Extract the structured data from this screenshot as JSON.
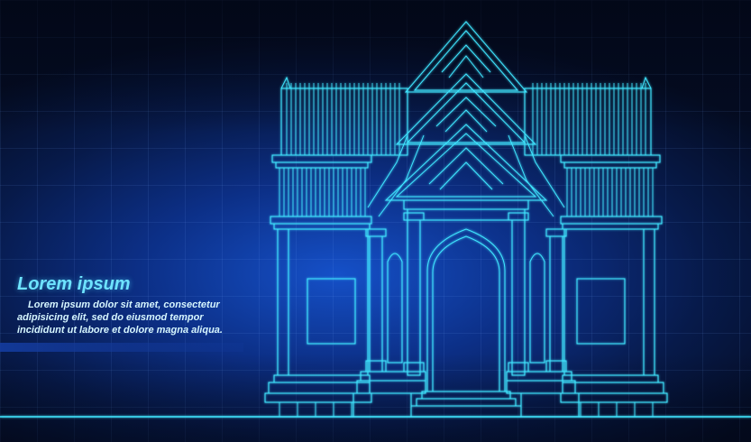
{
  "text_block": {
    "title": "Lorem ipsum",
    "body": "Lorem ipsum dolor sit amet, consectetur adipisicing elit, sed do eiusmod tempor incididunt ut labore et dolore magna aliqua."
  },
  "illustration": {
    "subject": "temple-gate-wireframe",
    "line_color": "#3fe6ff",
    "background_colors": [
      "#040c22",
      "#0c2f86",
      "#1550c8"
    ]
  }
}
